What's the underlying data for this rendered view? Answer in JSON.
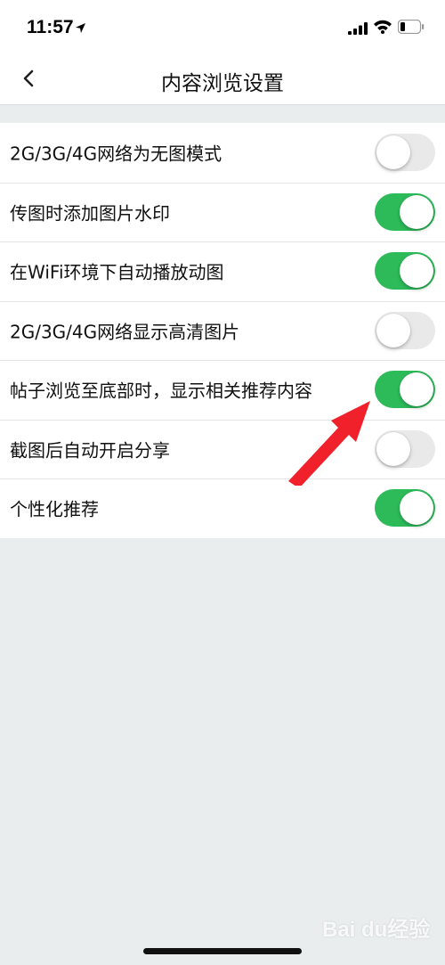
{
  "status_bar": {
    "time": "11:57"
  },
  "nav": {
    "title": "内容浏览设置",
    "back_icon": "chevron-left-icon"
  },
  "settings": [
    {
      "label": "2G/3G/4G网络为无图模式",
      "enabled": false
    },
    {
      "label": "传图时添加图片水印",
      "enabled": true
    },
    {
      "label": "在WiFi环境下自动播放动图",
      "enabled": true
    },
    {
      "label": "2G/3G/4G网络显示高清图片",
      "enabled": false
    },
    {
      "label": "帖子浏览至底部时，显示相关推荐内容",
      "enabled": true
    },
    {
      "label": "截图后自动开启分享",
      "enabled": false
    },
    {
      "label": "个性化推荐",
      "enabled": true
    }
  ],
  "annotation": {
    "icon": "red-arrow-icon",
    "color": "#f0212b"
  },
  "watermark": {
    "text": "Bai du经验"
  },
  "colors": {
    "toggle_on": "#2dbb5a",
    "toggle_off": "#e9e9ea",
    "background": "#e9edee"
  }
}
